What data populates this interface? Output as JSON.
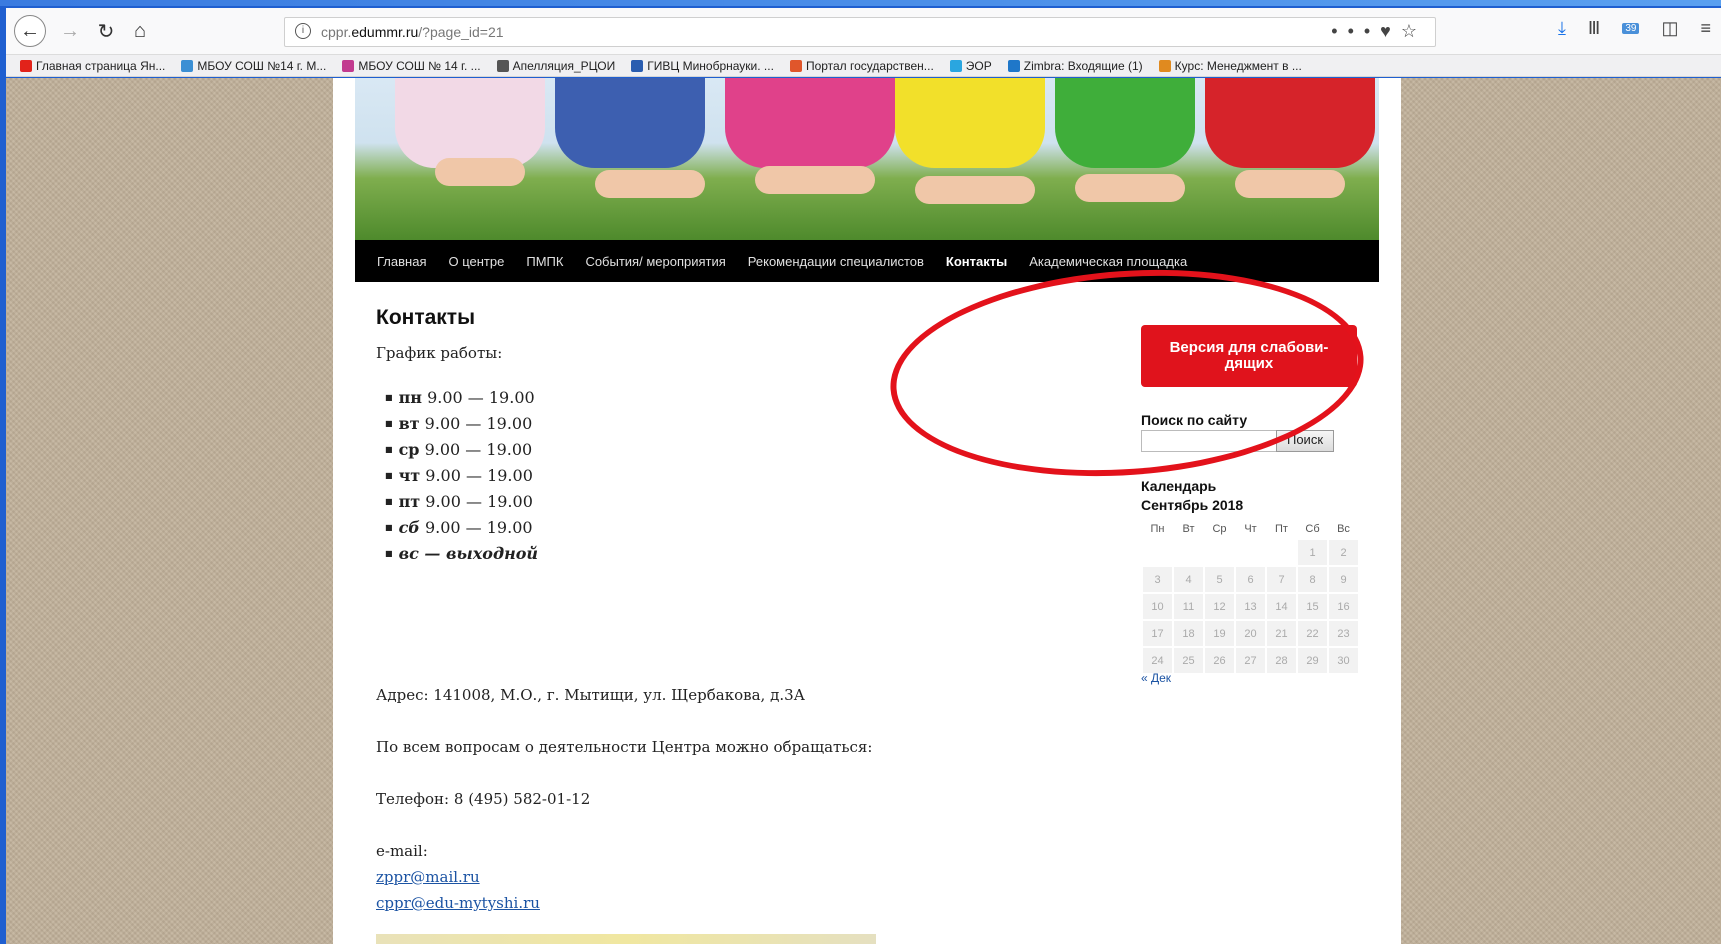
{
  "browser": {
    "url_prefix": "cppr.",
    "url_domain": "edummr.ru",
    "url_path": "/?page_id=21",
    "more_icon": "•••",
    "pocket_icon": "♥",
    "star_icon": "☆",
    "downloads_icon": "⤓",
    "library_icon": "Ⅲ",
    "badge_count": "39",
    "sidebar_icon": "◫",
    "menu_icon": "≡"
  },
  "bookmarks": [
    {
      "label": "Главная страница Ян...",
      "color": "#e2231a"
    },
    {
      "label": "МБОУ СОШ №14 г. М...",
      "color": "#3b8fd4"
    },
    {
      "label": "МБОУ СОШ № 14 г. ...",
      "color": "#c23b8f"
    },
    {
      "label": "Апелляция_РЦОИ",
      "color": "#555555"
    },
    {
      "label": "ГИВЦ Минобрнауки. ...",
      "color": "#2a5db0"
    },
    {
      "label": "Портал государствен...",
      "color": "#e0562b"
    },
    {
      "label": "ЭОР",
      "color": "#2aa6e0"
    },
    {
      "label": "Zimbra: Входящие (1)",
      "color": "#1f77c9"
    },
    {
      "label": "Курс: Менеджмент в ...",
      "color": "#e08a1f"
    }
  ],
  "nav": {
    "items": [
      "Главная",
      "О центре",
      "ПМПК",
      "События/ мероприятия",
      "Рекомендации специалистов",
      "Контакты",
      "Академическая площадка"
    ],
    "active_index": 5
  },
  "main": {
    "title": "Контакты",
    "schedule_title": "График работы:",
    "hours": [
      {
        "day": "пн",
        "time": " 9.00 — 19.00"
      },
      {
        "day": "вт",
        "time": " 9.00 — 19.00"
      },
      {
        "day": "ср",
        "time": " 9.00 — 19.00"
      },
      {
        "day": "чт",
        "time": " 9.00 — 19.00"
      },
      {
        "day": "пт",
        "time": " 9.00 — 19.00"
      },
      {
        "day": "сб",
        "time": " 9.00 — 19.00"
      },
      {
        "day": "вс — выходной",
        "time": ""
      }
    ],
    "address": "Адрес: 141008, М.О., г. Мытищи, ул. Щербакова, д.3А",
    "question": "По всем вопросам о деятельности Центра можно обращаться:",
    "phone": "Телефон: 8 (495) 582-01-12",
    "email_label": "e-mail:",
    "email1": "zppr@mail.ru",
    "email2": "cppr@edu-mytyshi.ru"
  },
  "sidebar": {
    "vi_button": "Версия для слабови-дящих",
    "search_title": "Поиск по сайту",
    "search_button": "Поиск",
    "calendar_title": "Календарь",
    "calendar_month": "Сентябрь 2018",
    "weekdays": [
      "Пн",
      "Вт",
      "Ср",
      "Чт",
      "Пт",
      "Сб",
      "Вс"
    ],
    "weeks": [
      [
        "",
        "",
        "",
        "",
        "",
        "1",
        "2"
      ],
      [
        "3",
        "4",
        "5",
        "6",
        "7",
        "8",
        "9"
      ],
      [
        "10",
        "11",
        "12",
        "13",
        "14",
        "15",
        "16"
      ],
      [
        "17",
        "18",
        "19",
        "20",
        "21",
        "22",
        "23"
      ],
      [
        "24",
        "25",
        "26",
        "27",
        "28",
        "29",
        "30"
      ]
    ],
    "prev_link": "« Дек"
  },
  "annotation_color": "#e3121b"
}
